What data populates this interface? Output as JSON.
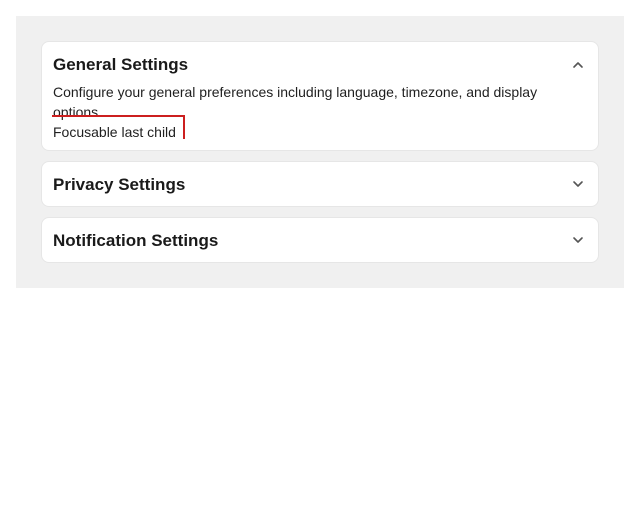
{
  "accordion": {
    "items": [
      {
        "title": "General Settings",
        "expanded": true,
        "description": "Configure your general preferences including language, timezone, and display options.",
        "focusable_child": "Focusable last child",
        "icon": "chevron-up-icon"
      },
      {
        "title": "Privacy Settings",
        "expanded": false,
        "icon": "chevron-down-icon"
      },
      {
        "title": "Notification Settings",
        "expanded": false,
        "icon": "chevron-down-icon"
      }
    ]
  },
  "colors": {
    "panel_background": "#f0f0f0",
    "card_background": "#ffffff",
    "focus_indicator": "#cc1f1f",
    "text": "#1a1a1a"
  }
}
